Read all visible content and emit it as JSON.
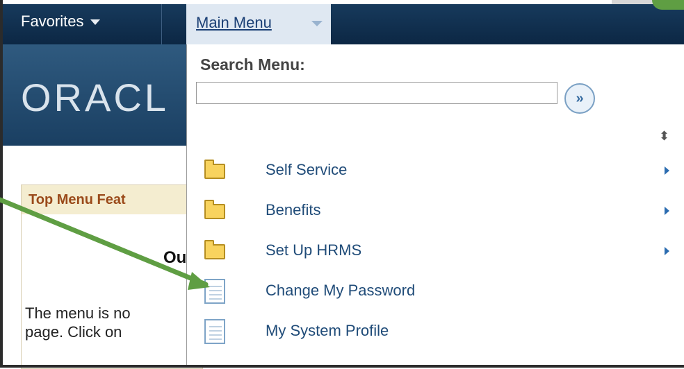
{
  "nav": {
    "favorites_label": "Favorites",
    "main_menu_label": "Main Menu"
  },
  "banner": {
    "logo_text": "ORACL"
  },
  "left_content": {
    "feature_header": "Top Menu Feat",
    "partial_word": "Ou",
    "body_line1": "The menu is no",
    "body_line2": "page. Click on"
  },
  "menu": {
    "search_label": "Search Menu:",
    "search_value": "",
    "search_button_text": "»",
    "items": [
      {
        "label": "Self Service",
        "type": "folder",
        "has_submenu": true
      },
      {
        "label": "Benefits",
        "type": "folder",
        "has_submenu": true
      },
      {
        "label": "Set Up HRMS",
        "type": "folder",
        "has_submenu": true
      },
      {
        "label": "Change My Password",
        "type": "page",
        "has_submenu": false
      },
      {
        "label": "My System Profile",
        "type": "page",
        "has_submenu": false
      }
    ]
  },
  "colors": {
    "navbar": "#0c2744",
    "banner": "#1a3f62",
    "accent_green": "#5f9e43",
    "link_blue": "#1f4b78"
  },
  "icons": {
    "menu_caret": "chevron-down-icon",
    "search_go": "double-chevron-right-icon",
    "sort": "sort-icon",
    "folder": "folder-icon",
    "page": "document-icon",
    "submenu": "triangle-right-icon"
  }
}
